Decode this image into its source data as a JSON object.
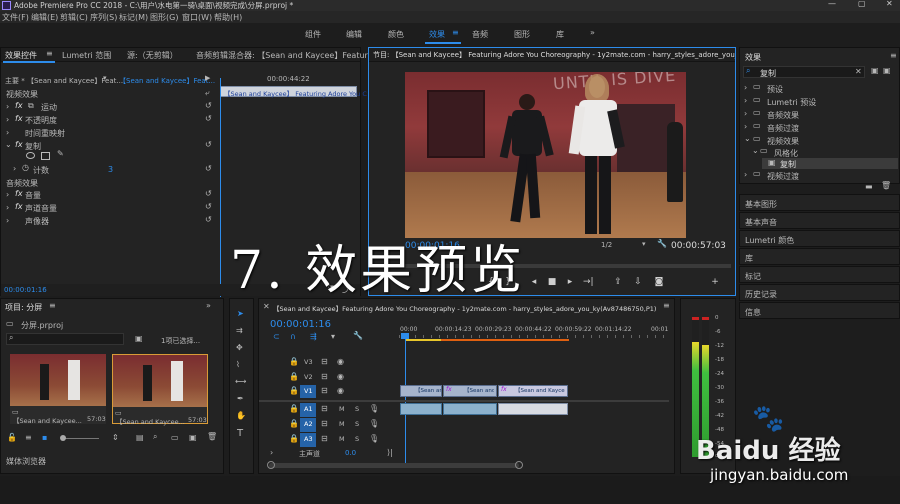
{
  "app": {
    "title": "Adobe Premiere Pro CC 2018 - C:\\用户\\水电第一骑\\桌面\\视频完成\\分屏.prproj *",
    "menu": [
      "文件(F)",
      "编辑(E)",
      "剪辑(C)",
      "序列(S)",
      "标记(M)",
      "图形(G)",
      "窗口(W)",
      "帮助(H)"
    ],
    "workspaces": [
      "组件",
      "编辑",
      "颜色",
      "效果",
      "音频",
      "图形",
      "库"
    ],
    "active_workspace": "效果"
  },
  "effect_controls": {
    "tabs": [
      "效果控件",
      "Lumetri 范围",
      "源:（无剪辑）",
      "音频剪辑混合器: 【Sean and Kaycee】Featur"
    ],
    "master": "主要 * 【Sean and Kaycee】Feat...",
    "sequence": "【Sean and Kaycee】Feat...",
    "timecode": "00:00:44:22",
    "clip_name": "【Sean and Kaycee】 Featuring Adore You C",
    "video_header": "视频效果",
    "video_effects": [
      "运动",
      "不透明度",
      "时间重映射",
      "复制"
    ],
    "count_label": "计数",
    "count_value": "3",
    "audio_header": "音频效果",
    "audio_effects": [
      "音量",
      "声道音量",
      "声像器"
    ],
    "bottom_timecode": "00:00:01:16"
  },
  "program": {
    "title": "节目: 【Sean and Kaycee】 Featuring Adore You Choreography - 1y2mate.com - harry_styles_adore_you_ky(Av87486",
    "timecode_left": "00:00:01:16",
    "zoom": "1/2",
    "timecode_right": "00:00:57:03",
    "wall_text": "UNTIL IS DIVE",
    "overlay_text": "7. 效果预览"
  },
  "effects_panel": {
    "title": "效果",
    "search_value": "复制",
    "tree": [
      "预设",
      "Lumetri 预设",
      "音频效果",
      "音频过渡",
      "视频效果",
      "风格化",
      "复制",
      "视频过渡"
    ],
    "sections": [
      "基本图形",
      "基本声音",
      "Lumetri 颜色",
      "库",
      "标记",
      "历史记录",
      "信息"
    ]
  },
  "project": {
    "title": "项目: 分屏",
    "file": "分屏.prproj",
    "selection": "1项已选择...",
    "items": [
      {
        "name": "【Sean and Kaycee...",
        "duration": "57:03"
      },
      {
        "name": "【Sean and Kaycee...",
        "duration": "57:03"
      }
    ],
    "media_browser": "媒体浏览器"
  },
  "timeline": {
    "title": "【Sean and Kaycee】Featuring Adore You Choreography - 1y2mate.com - harry_styles_adore_you_ky(Av87486750,P1)",
    "timecode": "00:00:01:16",
    "ruler": [
      "00:00",
      "00:00:14:23",
      "00:00:29:23",
      "00:00:44:22",
      "00:00:59:22",
      "00:01:14:22",
      "00:01"
    ],
    "video_tracks": [
      "V3",
      "V2",
      "V1"
    ],
    "audio_tracks": [
      "A1",
      "A2",
      "A3"
    ],
    "master_label": "主声道",
    "master_value": "0.0",
    "clip_label": "【Sean and Kaycee】",
    "fx": "fx"
  },
  "meter": {
    "labels": [
      "0",
      "-6",
      "-12",
      "-18",
      "-24",
      "-30",
      "-36",
      "-42",
      "-48",
      "-54",
      "dB"
    ],
    "level": 0.82
  },
  "watermark": {
    "brand": "Baidu 经验",
    "url": "jingyan.baidu.com"
  }
}
